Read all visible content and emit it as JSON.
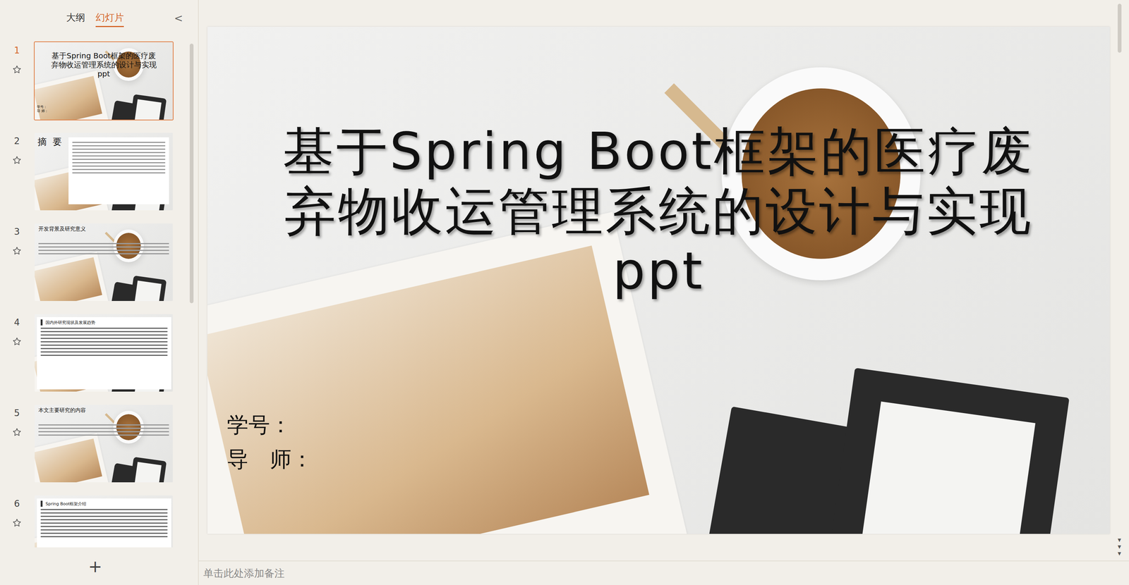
{
  "panel_tabs": [
    {
      "label": "大纲",
      "selected": false
    },
    {
      "label": "幻灯片",
      "selected": true
    }
  ],
  "collapse_button": "<",
  "slides": [
    {
      "number": "1",
      "kind": "title",
      "selected": true,
      "title_lines": [
        "基于Spring Boot框架的医疗废",
        "弃物收运管理系统的设计与实现",
        "ppt"
      ],
      "fields": [
        "学号：",
        "导 师："
      ]
    },
    {
      "number": "2",
      "kind": "text-box",
      "selected": false,
      "title_lines": [
        "摘 要"
      ],
      "fields": []
    },
    {
      "number": "3",
      "kind": "photo-text",
      "selected": false,
      "title_lines": [
        "开发背景及研究意义"
      ],
      "fields": []
    },
    {
      "number": "4",
      "kind": "panel",
      "selected": false,
      "title_lines": [
        "国内外研究现状及发展趋势"
      ],
      "fields": []
    },
    {
      "number": "5",
      "kind": "photo-text",
      "selected": false,
      "title_lines": [
        "本文主要研究的内容"
      ],
      "fields": []
    },
    {
      "number": "6",
      "kind": "panel",
      "selected": false,
      "title_lines": [
        "Spring Boot框架介绍"
      ],
      "fields": []
    }
  ],
  "add_slide_button": "+",
  "current_slide": {
    "title_lines": [
      "基于Spring Boot框架的医疗废",
      "弃物收运管理系统的设计与实现",
      "ppt"
    ],
    "fields": [
      "学号：",
      "导　师："
    ]
  },
  "notes_placeholder": "单击此处添加备注"
}
